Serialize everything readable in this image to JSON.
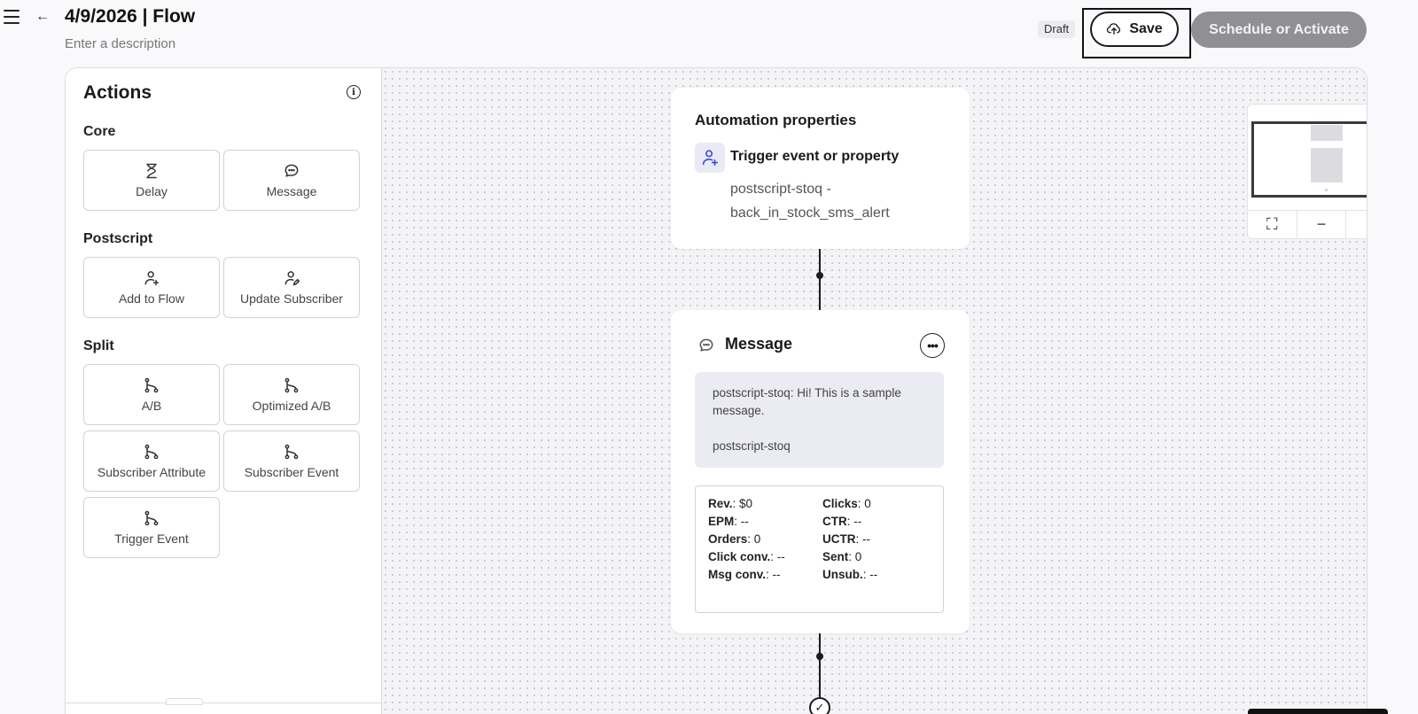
{
  "header": {
    "title": "4/9/2026 | Flow",
    "description_placeholder": "Enter a description",
    "status_badge": "Draft",
    "save_label": "Save",
    "schedule_label": "Schedule or Activate"
  },
  "sidebar": {
    "title": "Actions",
    "sections": [
      {
        "label": "Core",
        "items": [
          "Delay",
          "Message"
        ]
      },
      {
        "label": "Postscript",
        "items": [
          "Add to Flow",
          "Update Subscriber"
        ]
      },
      {
        "label": "Split",
        "items": [
          "A/B",
          "Optimized A/B",
          "Subscriber Attribute",
          "Subscriber Event",
          "Trigger Event"
        ]
      }
    ]
  },
  "canvas": {
    "properties_card": {
      "title": "Automation properties",
      "trigger_title": "Trigger event or property",
      "trigger_value": "postscript-stoq - back_in_stock_sms_alert"
    },
    "message_card": {
      "title": "Message",
      "preview_line1": "postscript-stoq: Hi! This is a sample message.",
      "preview_line2": "postscript-stoq",
      "stats": [
        {
          "key": "Rev.",
          "value": "$0"
        },
        {
          "key": "Clicks",
          "value": "0"
        },
        {
          "key": "EPM",
          "value": "--"
        },
        {
          "key": "CTR",
          "value": "--"
        },
        {
          "key": "Orders",
          "value": "0"
        },
        {
          "key": "UCTR",
          "value": "--"
        },
        {
          "key": "Click conv.",
          "value": "--"
        },
        {
          "key": "Sent",
          "value": "0"
        },
        {
          "key": "Msg conv.",
          "value": "--"
        },
        {
          "key": "Unsub.",
          "value": "--"
        }
      ]
    },
    "minimap_controls": [
      "fullscreen-icon",
      "zoom-out-icon",
      "zoom-in-icon"
    ]
  },
  "colors": {
    "schedule_button_bg": "#8f8f94",
    "preview_bg": "#ebebf3",
    "trigger_icon_bg": "#eaeaf4",
    "trigger_icon_color": "#3b4fd8"
  }
}
